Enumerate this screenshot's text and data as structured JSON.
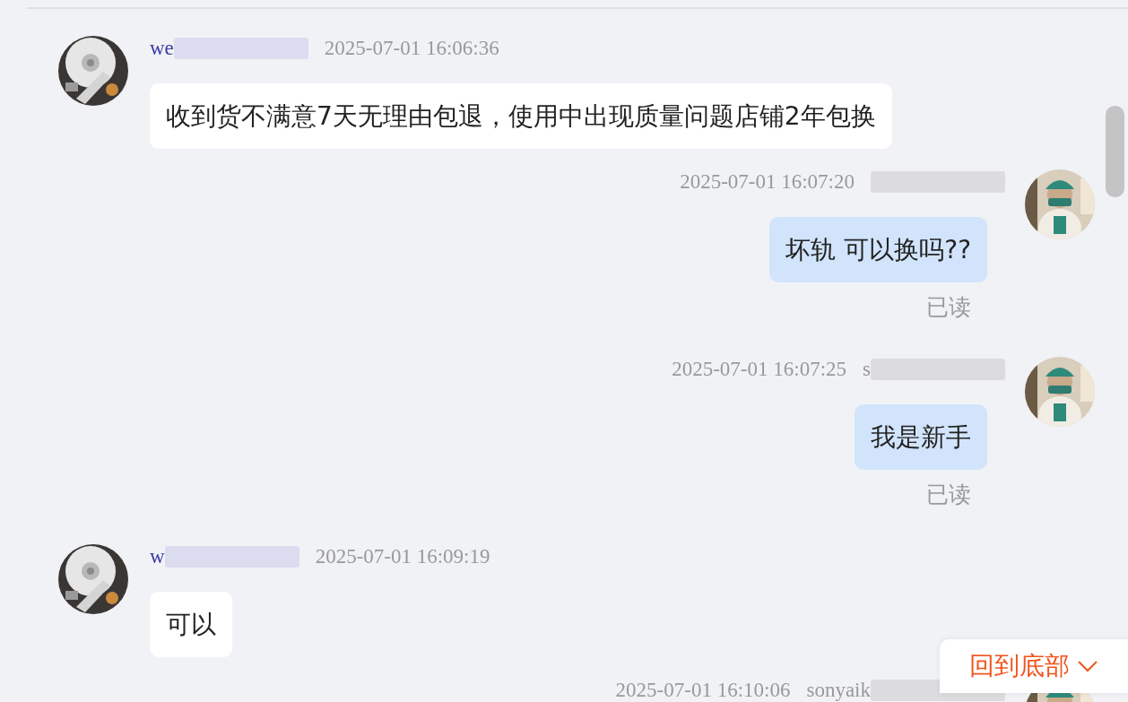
{
  "messages": [
    {
      "kind": "received",
      "sender": "we",
      "time": "2025-07-01 16:06:36",
      "text": "收到货不满意7天无理由包退，使用中出现质量问题店铺2年包换"
    },
    {
      "kind": "sent",
      "time": "2025-07-01 16:07:20",
      "text": "坏轨 可以换吗??",
      "status": "已读"
    },
    {
      "kind": "sent",
      "sender": "s",
      "time": "2025-07-01 16:07:25",
      "text": "我是新手",
      "status": "已读"
    },
    {
      "kind": "received",
      "sender": "w",
      "time": "2025-07-01 16:09:19",
      "text": "可以"
    },
    {
      "kind": "sent",
      "sender": "sonyaik",
      "time": "2025-07-01 16:10:06"
    }
  ],
  "jump_button": {
    "label": "回到底部"
  }
}
